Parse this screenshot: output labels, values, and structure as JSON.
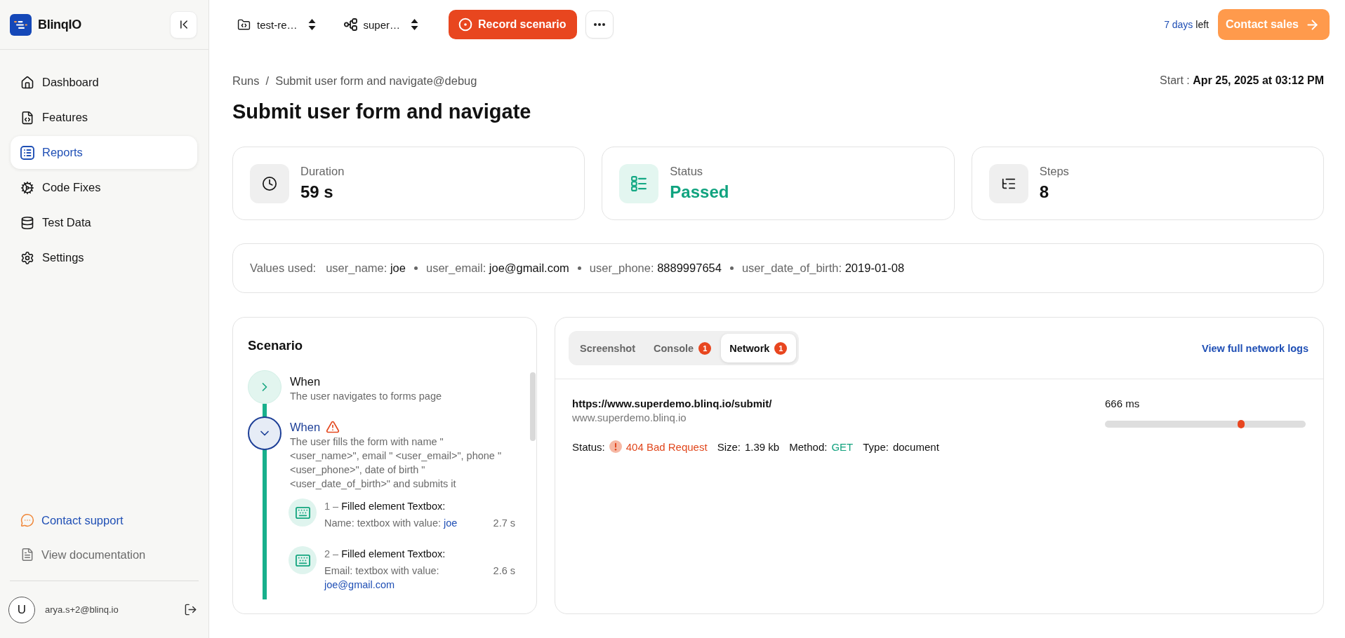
{
  "sidebar": {
    "brand": "BlinqIO",
    "nav": [
      {
        "kind": "dashboard",
        "label": "Dashboard",
        "selected": false
      },
      {
        "kind": "features",
        "label": "Features",
        "selected": false
      },
      {
        "kind": "reports",
        "label": "Reports",
        "selected": true
      },
      {
        "kind": "fixes",
        "label": "Code Fixes",
        "selected": false
      },
      {
        "kind": "data",
        "label": "Test Data",
        "selected": false
      },
      {
        "kind": "settings",
        "label": "Settings",
        "selected": false
      }
    ],
    "links": [
      {
        "kind": "support",
        "label": "Contact support"
      },
      {
        "kind": "docs",
        "label": "View documentation"
      }
    ],
    "user": {
      "initial": "U",
      "email": "arya.s+2@blinq.io"
    }
  },
  "topbar": {
    "selectors": [
      {
        "kind": "project",
        "value": "test-re…"
      },
      {
        "kind": "app",
        "value": "super…"
      }
    ],
    "record_button": "Record scenario",
    "trial": {
      "highlight": "7 days",
      "rest": "left"
    },
    "contact_button": "Contact sales"
  },
  "breadcrumb": {
    "items": [
      "Runs",
      "Submit user form and navigate@debug"
    ],
    "separator": "/"
  },
  "start": {
    "label": "Start :",
    "value": "Apr 25, 2025 at 03:12 PM"
  },
  "title": "Submit user form and navigate",
  "stats": [
    {
      "kind": "duration",
      "label": "Duration",
      "value": "59 s"
    },
    {
      "kind": "status",
      "label": "Status",
      "value": "Passed"
    },
    {
      "kind": "steps",
      "label": "Steps",
      "value": "8"
    }
  ],
  "values_used": {
    "label": "Values used:",
    "items": [
      {
        "key": "user_name:",
        "value": "joe"
      },
      {
        "key": "user_email:",
        "value": "joe@gmail.com"
      },
      {
        "key": "user_phone:",
        "value": "8889997654"
      },
      {
        "key": "user_date_of_birth:",
        "value": "2019-01-08"
      }
    ]
  },
  "scenario": {
    "title": "Scenario",
    "steps": [
      {
        "keyword": "When",
        "text": "The user navigates to forms page",
        "expanded": false,
        "warning": false
      },
      {
        "keyword": "When",
        "text": "The user fills the form with name \" <user_name>\", email \" <user_email>\", phone \" <user_phone>\", date of birth \" <user_date_of_birth>\" and submits it",
        "expanded": true,
        "warning": true,
        "actions": [
          {
            "number": "1 –",
            "title": "Filled element Textbox:",
            "detail": "Name: textbox with value:",
            "value": "joe",
            "time": "2.7 s"
          },
          {
            "number": "2 –",
            "title": "Filled element Textbox:",
            "detail": "Email: textbox with value:",
            "value": "joe@gmail.com",
            "time": "2.6 s"
          }
        ]
      }
    ]
  },
  "network": {
    "tabs": [
      {
        "label": "Screenshot",
        "selected": false
      },
      {
        "label": "Console",
        "badge": "1",
        "selected": false
      },
      {
        "label": "Network",
        "badge": "1",
        "selected": true
      }
    ],
    "link": "View full network logs",
    "requests": [
      {
        "url": "https://www.superdemo.blinq.io/submit/",
        "host": "www.superdemo.blinq.io",
        "duration": "666 ms",
        "level": 0.68,
        "fields": [
          {
            "kind": "status",
            "label": "Status:",
            "value": "404 Bad Request"
          },
          {
            "kind": "size",
            "label": "Size:",
            "value": "1.39 kb"
          },
          {
            "kind": "method",
            "label": "Method:",
            "value": "GET"
          },
          {
            "kind": "type",
            "label": "Type:",
            "value": "document"
          }
        ]
      }
    ]
  }
}
